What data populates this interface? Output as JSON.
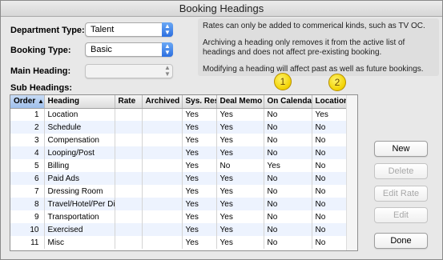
{
  "window": {
    "title": "Booking Headings"
  },
  "form": {
    "department_type_label": "Department Type:",
    "department_type_value": "Talent",
    "booking_type_label": "Booking Type:",
    "booking_type_value": "Basic",
    "main_heading_label": "Main Heading:",
    "main_heading_value": "",
    "sub_headings_label": "Sub Headings:"
  },
  "info": {
    "line1": "Rates can only be added to commerical kinds, such as TV OC.",
    "line2": "Archiving a heading only removes it from the active list of headings and does not affect pre-existing booking.",
    "line3": "Modifying a heading will affect past as well as future bookings."
  },
  "callouts": [
    "1",
    "2"
  ],
  "table": {
    "columns": [
      "Order",
      "Heading",
      "Rate",
      "Archived",
      "Sys. Res.",
      "Deal Memo",
      "On Calendar",
      "Location"
    ],
    "sort_indicator": "▲",
    "rows": [
      [
        "1",
        "Location",
        "",
        "",
        "Yes",
        "Yes",
        "No",
        "Yes"
      ],
      [
        "2",
        "Schedule",
        "",
        "",
        "Yes",
        "Yes",
        "No",
        "No"
      ],
      [
        "3",
        "Compensation",
        "",
        "",
        "Yes",
        "Yes",
        "No",
        "No"
      ],
      [
        "4",
        "Looping/Post",
        "",
        "",
        "Yes",
        "Yes",
        "No",
        "No"
      ],
      [
        "5",
        "Billing",
        "",
        "",
        "Yes",
        "No",
        "Yes",
        "No"
      ],
      [
        "6",
        "Paid Ads",
        "",
        "",
        "Yes",
        "Yes",
        "No",
        "No"
      ],
      [
        "7",
        "Dressing Room",
        "",
        "",
        "Yes",
        "Yes",
        "No",
        "No"
      ],
      [
        "8",
        "Travel/Hotel/Per Die",
        "",
        "",
        "Yes",
        "Yes",
        "No",
        "No"
      ],
      [
        "9",
        "Transportation",
        "",
        "",
        "Yes",
        "Yes",
        "No",
        "No"
      ],
      [
        "10",
        "Exercised",
        "",
        "",
        "Yes",
        "Yes",
        "No",
        "No"
      ],
      [
        "11",
        "Misc",
        "",
        "",
        "Yes",
        "Yes",
        "No",
        "No"
      ]
    ]
  },
  "buttons": {
    "new": "New",
    "delete": "Delete",
    "edit_rate": "Edit Rate",
    "edit": "Edit",
    "done": "Done"
  },
  "colors": {
    "select_arrow": "#2c6fe0",
    "callout": "#f2d200",
    "row_alt": "#edf3fe"
  }
}
